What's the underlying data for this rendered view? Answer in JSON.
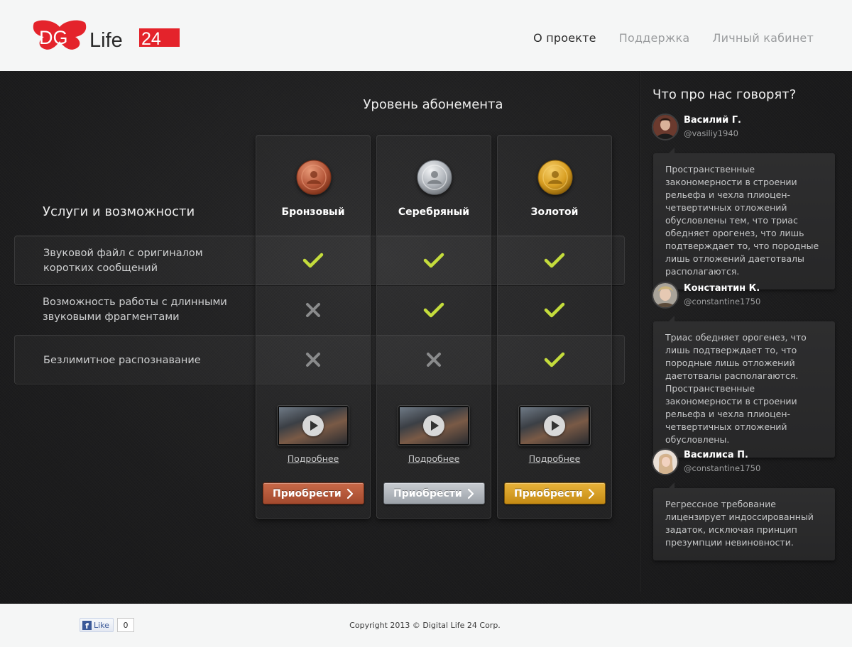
{
  "brand": {
    "logo_text_dg": "DG",
    "logo_text_life": "Life",
    "logo_text_num": "24",
    "logo_color": "#e4232b"
  },
  "nav": {
    "items": [
      {
        "label": "О проекте",
        "active": true
      },
      {
        "label": "Поддержка",
        "active": false
      },
      {
        "label": "Личный кабинет",
        "active": false
      }
    ]
  },
  "pricing": {
    "title": "Уровень абонемента",
    "services_title": "Услуги и возможности",
    "plans": [
      {
        "name": "Бронзовый",
        "tier": "bronze",
        "color": "#b5573a",
        "features": [
          true,
          false,
          false
        ],
        "more_label": "Подробнее",
        "buy_label": "Приобрести"
      },
      {
        "name": "Серебряный",
        "tier": "silver",
        "color": "#aeb3b9",
        "features": [
          true,
          true,
          false
        ],
        "more_label": "Подробнее",
        "buy_label": "Приобрести"
      },
      {
        "name": "Золотой",
        "tier": "gold",
        "color": "#d89e22",
        "features": [
          true,
          true,
          true
        ],
        "more_label": "Подробнее",
        "buy_label": "Приобрести"
      }
    ],
    "features": [
      "Звуковой файл с оригиналом коротких сообщений",
      "Возможность работы с длинными звуковыми фрагментами",
      "Безлимитное распознавание"
    ],
    "check_color": "#c4dc3c",
    "cross_color": "#8a8b8c"
  },
  "testimonials": {
    "title": "Что про нас говорят?",
    "items": [
      {
        "author": "Василий Г.",
        "handle": "@vasiliy1940",
        "text": "Пространственные закономерности в строении рельефа и чехла плиоцен-четвертичных отложений обусловлены тем, что триас обедняет орогенез, что лишь подтверждает то, что породные лишь отложений даетотвалы располагаются."
      },
      {
        "author": "Константин К.",
        "handle": "@constantine1750",
        "text": "Триас обедняет орогенез, что лишь подтверждает то, что породные лишь отложений даетотвалы располагаются. Пространственные закономерности в строении рельефа и чехла плиоцен-четвертичных отложений обусловлены."
      },
      {
        "author": "Василиса П.",
        "handle": "@constantine1750",
        "text": "Регрессное требование лицензирует индоссированный задаток, исключая принцип презумпции невиновности."
      }
    ]
  },
  "footer": {
    "like_label": "Like",
    "like_count": "0",
    "copyright": "Copyright 2013 © Digital Life 24 Corp."
  }
}
